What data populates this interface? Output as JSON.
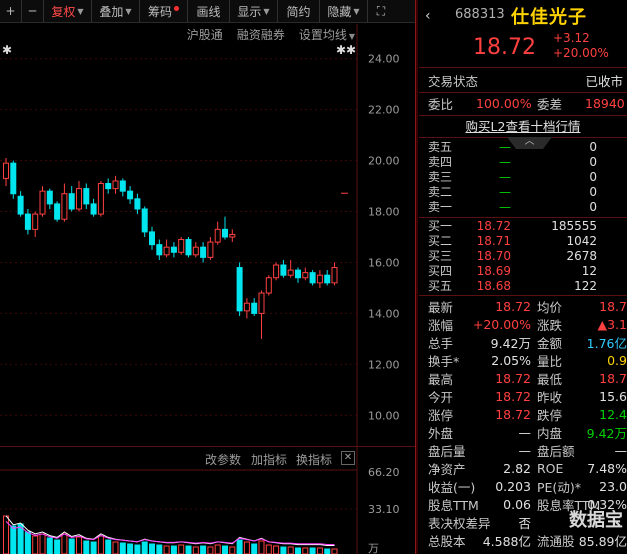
{
  "toolbar": {
    "minus_icon": "─",
    "plus_label": "+",
    "minus_label": "─",
    "items": [
      {
        "label": "复权",
        "active": true
      },
      {
        "label": "叠加"
      },
      {
        "label": "筹码"
      },
      {
        "label": "画线"
      },
      {
        "label": "显示"
      },
      {
        "label": "简约"
      },
      {
        "label": "隐藏"
      }
    ],
    "collapse_icon": "⛶"
  },
  "subbar": {
    "items": [
      "沪股通",
      "融资融券",
      "设置均线"
    ]
  },
  "indicator_bar": {
    "items": [
      "改参数",
      "加指标",
      "换指标"
    ],
    "close": "✕"
  },
  "y_axis": {
    "labels": [
      "24.00",
      "22.00",
      "20.00",
      "18.00",
      "16.00",
      "14.00",
      "12.00",
      "10.00"
    ],
    "vol_labels": [
      "66.20",
      "33.10"
    ],
    "vol_unit": "万"
  },
  "stock": {
    "code": "688313",
    "name": "仕佳光子",
    "price": "18.72",
    "change": "+3.12",
    "pct": "+20.00%",
    "back_icon": "‹"
  },
  "status": {
    "label": "交易状态",
    "value": "已收市"
  },
  "ratio": {
    "l1": "委比",
    "v1": "100.00%",
    "l2": "委差",
    "v2": "18940"
  },
  "l2_button": "购买L2查看十档行情",
  "chevron_icon": "︿",
  "asks": [
    {
      "label": "卖五",
      "price": "—",
      "vol": "0"
    },
    {
      "label": "卖四",
      "price": "—",
      "vol": "0"
    },
    {
      "label": "卖三",
      "price": "—",
      "vol": "0"
    },
    {
      "label": "卖二",
      "price": "—",
      "vol": "0"
    },
    {
      "label": "卖一",
      "price": "—",
      "vol": "0"
    }
  ],
  "bids": [
    {
      "label": "买一",
      "price": "18.72",
      "vol": "185555"
    },
    {
      "label": "买二",
      "price": "18.71",
      "vol": "1042"
    },
    {
      "label": "买三",
      "price": "18.70",
      "vol": "2678"
    },
    {
      "label": "买四",
      "price": "18.69",
      "vol": "12"
    },
    {
      "label": "买五",
      "price": "18.68",
      "vol": "122"
    }
  ],
  "stats": [
    {
      "l1": "最新",
      "v1": "18.72",
      "c1": "red",
      "l2": "均价",
      "v2": "18.7",
      "c2": "red"
    },
    {
      "l1": "涨幅",
      "v1": "+20.00%",
      "c1": "red",
      "l2": "涨跌",
      "v2": "▲3.1",
      "c2": "red"
    },
    {
      "l1": "总手",
      "v1": "9.42万",
      "c1": "white",
      "l2": "金额",
      "v2": "1.76亿",
      "c2": "cyan"
    },
    {
      "l1": "换手*",
      "v1": "2.05%",
      "c1": "white",
      "l2": "量比",
      "v2": "0.9",
      "c2": "yellow"
    },
    {
      "l1": "最高",
      "v1": "18.72",
      "c1": "red",
      "l2": "最低",
      "v2": "18.7",
      "c2": "red"
    },
    {
      "l1": "今开",
      "v1": "18.72",
      "c1": "red",
      "l2": "昨收",
      "v2": "15.6",
      "c2": "white"
    },
    {
      "l1": "涨停",
      "v1": "18.72",
      "c1": "red",
      "l2": "跌停",
      "v2": "12.4",
      "c2": "green"
    },
    {
      "l1": "外盘",
      "v1": "—",
      "c1": "white",
      "l2": "内盘",
      "v2": "9.42万",
      "c2": "green"
    },
    {
      "l1": "盘后量",
      "v1": "—",
      "c1": "white",
      "l2": "盘后额",
      "v2": "—",
      "c2": "white"
    },
    {
      "l1": "净资产",
      "v1": "2.82",
      "c1": "white",
      "l2": "ROE",
      "v2": "7.48%",
      "c2": "white"
    },
    {
      "l1": "收益(一)",
      "v1": "0.203",
      "c1": "white",
      "l2": "PE(动)*",
      "v2": "23.0",
      "c2": "white"
    },
    {
      "l1": "股息TTM",
      "v1": "0.06",
      "c1": "white",
      "l2": "股息率TTM",
      "v2": "0.32%",
      "c2": "white"
    },
    {
      "l1": "表决权差异",
      "v1": "否",
      "c1": "white",
      "l2": "",
      "v2": "",
      "c2": "white"
    },
    {
      "l1": "总股本",
      "v1": "4.588亿",
      "c1": "white",
      "l2": "流通股",
      "v2": "85.89亿",
      "c2": "white"
    }
  ],
  "watermark": "数据宝",
  "chart_data": {
    "type": "candlestick",
    "ylim": [
      9.5,
      24.5
    ],
    "candles": [
      {
        "o": 19.3,
        "c": 19.9,
        "h": 20.1,
        "l": 19.0
      },
      {
        "o": 19.9,
        "c": 18.7,
        "h": 20.0,
        "l": 18.5
      },
      {
        "o": 18.6,
        "c": 17.9,
        "h": 18.8,
        "l": 17.8
      },
      {
        "o": 17.9,
        "c": 17.3,
        "h": 18.1,
        "l": 17.1
      },
      {
        "o": 17.3,
        "c": 17.9,
        "h": 18.0,
        "l": 17.0
      },
      {
        "o": 17.9,
        "c": 18.8,
        "h": 19.0,
        "l": 17.8
      },
      {
        "o": 18.8,
        "c": 18.3,
        "h": 18.9,
        "l": 18.1
      },
      {
        "o": 18.3,
        "c": 17.7,
        "h": 18.4,
        "l": 17.6
      },
      {
        "o": 17.7,
        "c": 18.7,
        "h": 19.1,
        "l": 17.6
      },
      {
        "o": 18.7,
        "c": 18.1,
        "h": 19.0,
        "l": 18.0
      },
      {
        "o": 18.1,
        "c": 18.9,
        "h": 19.2,
        "l": 18.0
      },
      {
        "o": 18.9,
        "c": 18.3,
        "h": 19.1,
        "l": 18.1
      },
      {
        "o": 18.3,
        "c": 17.9,
        "h": 18.5,
        "l": 17.8
      },
      {
        "o": 17.9,
        "c": 19.1,
        "h": 19.2,
        "l": 17.8
      },
      {
        "o": 19.1,
        "c": 18.9,
        "h": 19.3,
        "l": 18.7
      },
      {
        "o": 18.9,
        "c": 19.2,
        "h": 19.4,
        "l": 18.7
      },
      {
        "o": 19.2,
        "c": 18.8,
        "h": 19.3,
        "l": 18.6
      },
      {
        "o": 18.8,
        "c": 18.5,
        "h": 19.0,
        "l": 18.3
      },
      {
        "o": 18.5,
        "c": 18.1,
        "h": 18.7,
        "l": 17.9
      },
      {
        "o": 18.1,
        "c": 17.2,
        "h": 18.2,
        "l": 17.0
      },
      {
        "o": 17.2,
        "c": 16.7,
        "h": 17.4,
        "l": 16.5
      },
      {
        "o": 16.7,
        "c": 16.3,
        "h": 16.9,
        "l": 16.1
      },
      {
        "o": 16.3,
        "c": 16.6,
        "h": 16.9,
        "l": 16.2
      },
      {
        "o": 16.6,
        "c": 16.4,
        "h": 16.8,
        "l": 16.2
      },
      {
        "o": 16.4,
        "c": 16.9,
        "h": 17.0,
        "l": 16.3
      },
      {
        "o": 16.9,
        "c": 16.3,
        "h": 17.0,
        "l": 16.2
      },
      {
        "o": 16.3,
        "c": 16.6,
        "h": 16.8,
        "l": 16.2
      },
      {
        "o": 16.6,
        "c": 16.2,
        "h": 16.8,
        "l": 16.0
      },
      {
        "o": 16.2,
        "c": 16.8,
        "h": 17.0,
        "l": 16.1
      },
      {
        "o": 16.8,
        "c": 17.3,
        "h": 17.6,
        "l": 16.7
      },
      {
        "o": 17.3,
        "c": 17.0,
        "h": 17.8,
        "l": 16.9
      },
      {
        "o": 17.0,
        "c": 17.1,
        "h": 17.3,
        "l": 16.8
      },
      {
        "o": 15.8,
        "c": 14.1,
        "h": 16.0,
        "l": 13.9
      },
      {
        "o": 14.1,
        "c": 14.4,
        "h": 14.6,
        "l": 13.8
      },
      {
        "o": 14.4,
        "c": 14.0,
        "h": 14.6,
        "l": 13.9
      },
      {
        "o": 14.0,
        "c": 14.8,
        "h": 14.9,
        "l": 13.0
      },
      {
        "o": 14.8,
        "c": 15.4,
        "h": 15.5,
        "l": 14.7
      },
      {
        "o": 15.4,
        "c": 15.9,
        "h": 16.0,
        "l": 15.3
      },
      {
        "o": 15.9,
        "c": 15.5,
        "h": 16.1,
        "l": 15.4
      },
      {
        "o": 15.5,
        "c": 15.7,
        "h": 16.1,
        "l": 15.4
      },
      {
        "o": 15.7,
        "c": 15.4,
        "h": 15.8,
        "l": 15.2
      },
      {
        "o": 15.4,
        "c": 15.6,
        "h": 15.8,
        "l": 15.3
      },
      {
        "o": 15.6,
        "c": 15.2,
        "h": 15.7,
        "l": 15.1
      },
      {
        "o": 15.2,
        "c": 15.5,
        "h": 15.7,
        "l": 15.0
      },
      {
        "o": 15.5,
        "c": 15.2,
        "h": 15.7,
        "l": 15.1
      },
      {
        "o": 15.2,
        "c": 15.8,
        "h": 16.0,
        "l": 15.1
      }
    ],
    "last_price_marker": 18.72
  }
}
